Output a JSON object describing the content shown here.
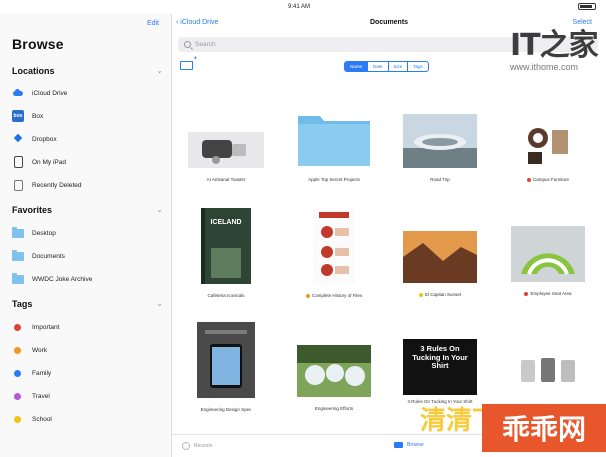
{
  "status": {
    "time": "9:41 AM"
  },
  "sidebar": {
    "edit_label": "Edit",
    "title": "Browse",
    "sections": {
      "locations": "Locations",
      "favorites": "Favorites",
      "tags": "Tags"
    },
    "locations": [
      {
        "label": "iCloud Drive",
        "icon": "icloud-icon"
      },
      {
        "label": "Box",
        "icon": "box-icon"
      },
      {
        "label": "Dropbox",
        "icon": "dropbox-icon"
      },
      {
        "label": "On My iPad",
        "icon": "ipad-icon"
      },
      {
        "label": "Recently Deleted",
        "icon": "trash-icon"
      }
    ],
    "favorites": [
      {
        "label": "Desktop",
        "icon": "folder-icon"
      },
      {
        "label": "Documents",
        "icon": "folder-icon"
      },
      {
        "label": "WWDC Joke Archive",
        "icon": "folder-icon"
      }
    ],
    "tags": [
      {
        "label": "Important",
        "color": "#e0413a"
      },
      {
        "label": "Work",
        "color": "#f0962a"
      },
      {
        "label": "Family",
        "color": "#2a7cf6"
      },
      {
        "label": "Travel",
        "color": "#b35ad9"
      },
      {
        "label": "School",
        "color": "#f3c316"
      }
    ]
  },
  "main": {
    "back_label": "iCloud Drive",
    "title": "Documents",
    "select_label": "Select",
    "search_placeholder": "Search",
    "sort_options": [
      "Name",
      "Date",
      "Size",
      "Tags"
    ],
    "files": [
      {
        "name": "AI Artisanal Toaster",
        "tag_color": ""
      },
      {
        "name": "Apple Top Secret Projects",
        "tag_color": ""
      },
      {
        "name": "Road Trip",
        "tag_color": ""
      },
      {
        "name": "Campus Furniture",
        "tag_color": "#e0413a"
      },
      {
        "name": "Cafeteria Iconicals",
        "tag_color": ""
      },
      {
        "name": "Complete History of Files",
        "tag_color": "#f0962a"
      },
      {
        "name": "El Capitan Sunset",
        "tag_color": "#f3c316"
      },
      {
        "name": "Employee Seat Area",
        "tag_color": "#e0413a"
      },
      {
        "name": "Engineering Design Spec",
        "tag_color": ""
      },
      {
        "name": "Engineering Efforts",
        "tag_color": ""
      },
      {
        "name": "3 Rules On Tucking In Your Shirt",
        "tag_color": ""
      },
      {
        "name": "",
        "tag_color": ""
      }
    ],
    "poster_text": "3 Rules On Tucking In Your Shirt",
    "book_text": "ICELAND",
    "tabs": {
      "recents": "Recents",
      "browse": "Browse"
    }
  },
  "watermark": {
    "brand": "IT之家",
    "url": "www.ithome.com",
    "bottom_yellow": "清清下载网",
    "bottom_red": "乖乖网"
  }
}
